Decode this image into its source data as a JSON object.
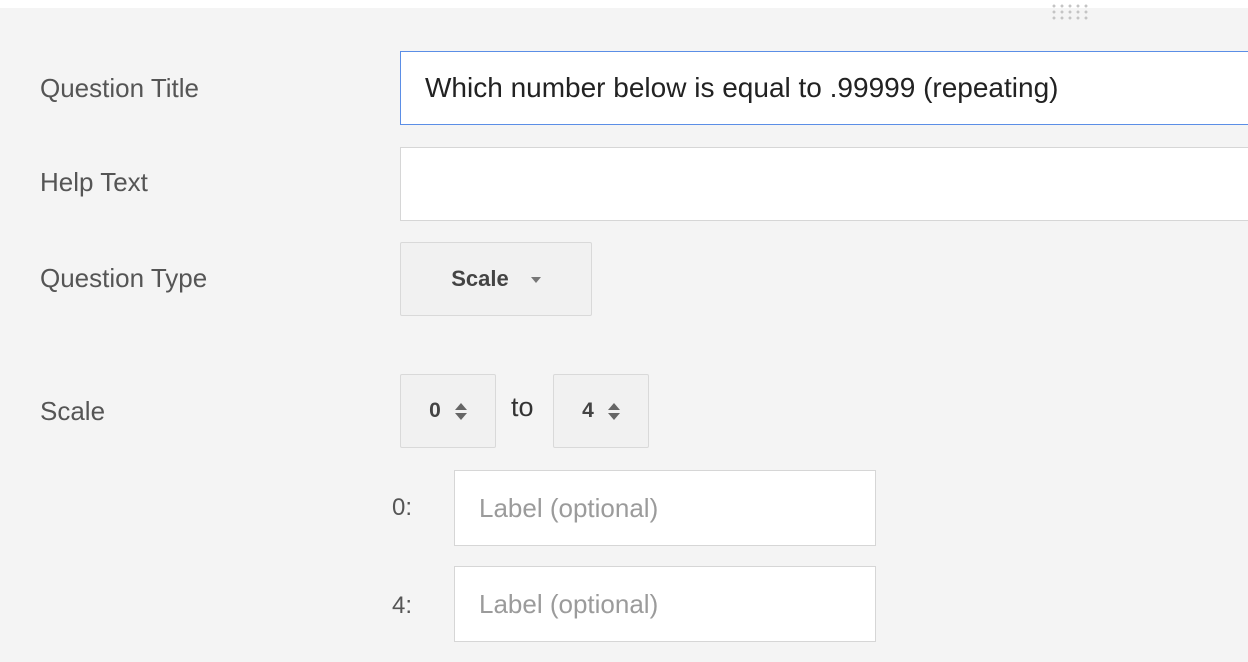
{
  "form": {
    "question_title": {
      "label": "Question Title",
      "value": "Which number below is equal to .99999 (repeating)"
    },
    "help_text": {
      "label": "Help Text",
      "value": ""
    },
    "question_type": {
      "label": "Question Type",
      "selected": "Scale"
    },
    "scale": {
      "label": "Scale",
      "from_value": "0",
      "separator": "to",
      "to_value": "4",
      "low_label": {
        "prefix": "0:",
        "placeholder": "Label (optional)"
      },
      "high_label": {
        "prefix": "4:",
        "placeholder": "Label (optional)"
      }
    }
  },
  "icons": {
    "drag_handle": "drag-dots-icon",
    "dropdown_caret": "caret-down-icon",
    "stepper_arrows": "up-down-arrows-icon"
  },
  "colors": {
    "panel_background": "#f4f4f4",
    "focus_border": "#5b8ee6",
    "field_border": "#d6d6d6",
    "label_text": "#555555"
  }
}
